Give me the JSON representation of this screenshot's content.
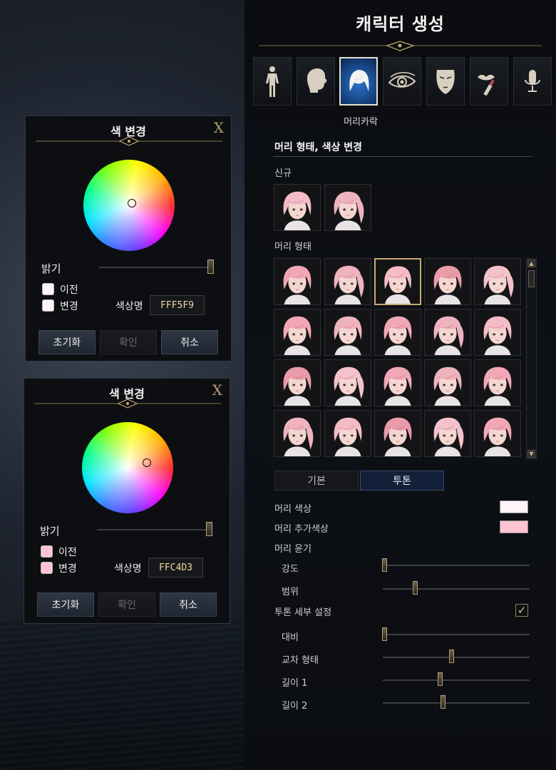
{
  "title": "캐릭터 생성",
  "tabs": [
    {
      "icon": "body-icon"
    },
    {
      "icon": "head-icon"
    },
    {
      "icon": "hair-icon",
      "active": true
    },
    {
      "icon": "eye-icon"
    },
    {
      "icon": "face-mask-icon"
    },
    {
      "icon": "makeup-icon"
    },
    {
      "icon": "voice-icon"
    }
  ],
  "tab_caption": "머리카락",
  "section_title": "머리 형태, 색상 변경",
  "new_label": "신규",
  "hair_style_label": "머리 형태",
  "subtabs": {
    "basic": "기본",
    "toon": "투톤"
  },
  "hair_color_label": "머리 색상",
  "hair_color_value": "#FFF5F9",
  "hair_extra_color_label": "머리 추가색상",
  "hair_extra_color_value": "#FFC4D3",
  "hair_gloss_label": "머리 윤기",
  "sliders": [
    {
      "label": "강도",
      "value": 0.0
    },
    {
      "label": "범위",
      "value": 0.22
    },
    {
      "label": "투톤 세부 설정",
      "checkbox": true
    },
    {
      "label": "대비",
      "value": 0.0
    },
    {
      "label": "교차 형태",
      "value": 0.46
    },
    {
      "label": "길이 1",
      "value": 0.38
    },
    {
      "label": "길이 2",
      "value": 0.4
    }
  ],
  "toon_detail_label": "투톤 세부 설정",
  "toon_detail_checked": "✓",
  "dialogs": [
    {
      "title": "색 변경",
      "close": "X",
      "brightness_label": "밝기",
      "brightness": 1.0,
      "prev_label": "이전",
      "new_label": "변경",
      "prev_color": "#FFF5F9",
      "new_color": "#FFF5F9",
      "color_name_label": "색상명",
      "hex": "FFF5F9",
      "buttons": {
        "reset": "초기화",
        "confirm": "확인",
        "cancel": "취소"
      }
    },
    {
      "title": "색 변경",
      "close": "X",
      "brightness_label": "밝기",
      "brightness": 1.0,
      "prev_label": "이전",
      "new_label": "변경",
      "prev_color": "#FFC4D3",
      "new_color": "#FFC4D3",
      "color_name_label": "색상명",
      "hex": "FFC4D3",
      "buttons": {
        "reset": "초기화",
        "confirm": "확인",
        "cancel": "취소"
      }
    }
  ],
  "accent_gold": "#C8AB73",
  "active_tab_blue": "#2B72C9"
}
